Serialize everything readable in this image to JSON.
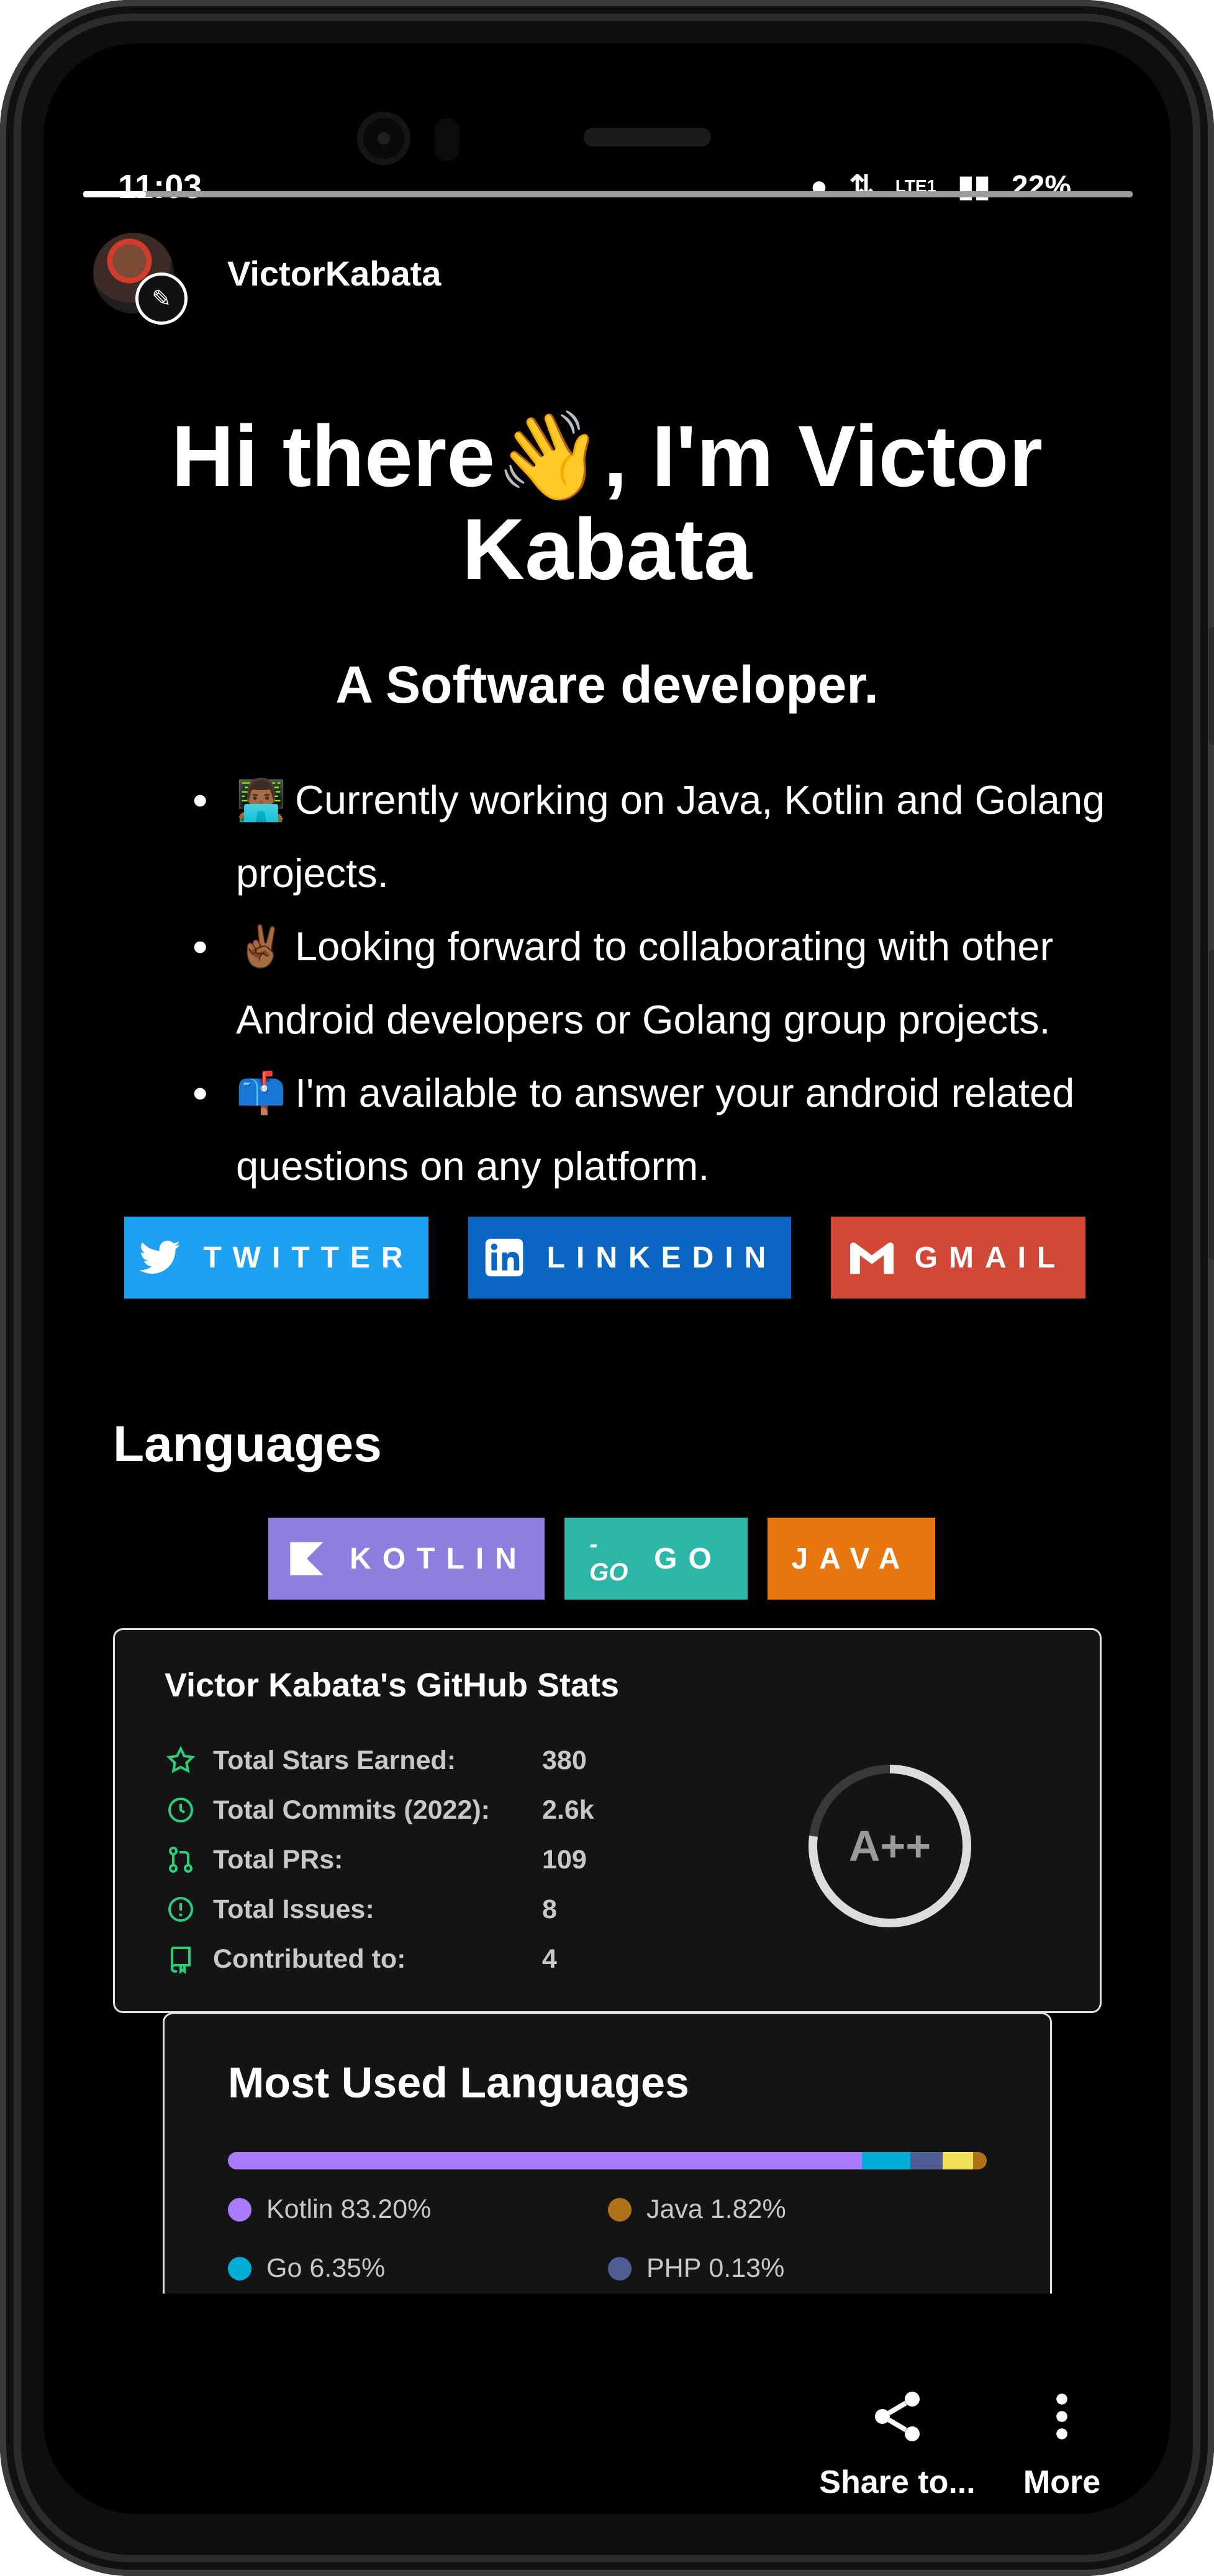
{
  "status_bar": {
    "time": "11:03",
    "network": "LTE1",
    "battery": "22%"
  },
  "profile": {
    "username": "VictorKabata"
  },
  "readme": {
    "heading": "Hi there👋, I'm Victor Kabata",
    "subheading": "A Software developer.",
    "bullets": [
      {
        "emoji": "👨🏾‍💻",
        "text": "Currently working on Java, Kotlin and Golang projects."
      },
      {
        "emoji": "✌🏾",
        "text": "Looking forward to collaborating with other Android developers or Golang group projects."
      },
      {
        "emoji": "📫",
        "text": "I'm available to answer your android related questions on any platform."
      }
    ],
    "social_badges": [
      {
        "label": "TWITTER",
        "color": "#1DA1F2",
        "icon": "twitter-icon"
      },
      {
        "label": "LINKEDIN",
        "color": "#0A66C2",
        "icon": "linkedin-icon"
      },
      {
        "label": "GMAIL",
        "color": "#D14836",
        "icon": "gmail-icon"
      }
    ],
    "languages_title": "Languages",
    "language_badges": [
      {
        "label": "KOTLIN",
        "color": "#7F52FF",
        "icon": "kotlin-icon"
      },
      {
        "label": "GO",
        "color": "#00ADD8",
        "icon": "go-icon"
      },
      {
        "label": "JAVA",
        "color": "#ED8B00",
        "icon": "java-icon"
      }
    ]
  },
  "stats": {
    "title": "Victor Kabata's GitHub Stats",
    "rows": [
      {
        "label": "Total Stars Earned:",
        "value": "380",
        "icon": "star-icon"
      },
      {
        "label": "Total Commits (2022):",
        "value": "2.6k",
        "icon": "history-icon"
      },
      {
        "label": "Total PRs:",
        "value": "109",
        "icon": "pull-request-icon"
      },
      {
        "label": "Total Issues:",
        "value": "8",
        "icon": "issue-icon"
      },
      {
        "label": "Contributed to:",
        "value": "4",
        "icon": "repo-icon"
      }
    ],
    "grade": "A++"
  },
  "most_used_languages": {
    "title": "Most Used Languages",
    "items": [
      {
        "name": "Kotlin",
        "percent": "83.20%",
        "color": "#A97BFF"
      },
      {
        "name": "Go",
        "percent": "6.35%",
        "color": "#00ADD8"
      },
      {
        "name": "PHP",
        "percent": "0.13%",
        "color": "#4F5D95"
      },
      {
        "name": "Java",
        "percent": "1.82%",
        "color": "#B07219"
      }
    ],
    "bar_segments": [
      {
        "color": "#A97BFF",
        "fraction": 0.832
      },
      {
        "color": "#00ADD8",
        "fraction": 0.0635
      },
      {
        "color": "#4F5D95",
        "fraction": 0.042
      },
      {
        "color": "#F1E05A",
        "fraction": 0.04
      },
      {
        "color": "#B07219",
        "fraction": 0.0182
      }
    ]
  },
  "bottom_actions": {
    "share_label": "Share to...",
    "more_label": "More"
  },
  "page_load_progress": 0.06
}
